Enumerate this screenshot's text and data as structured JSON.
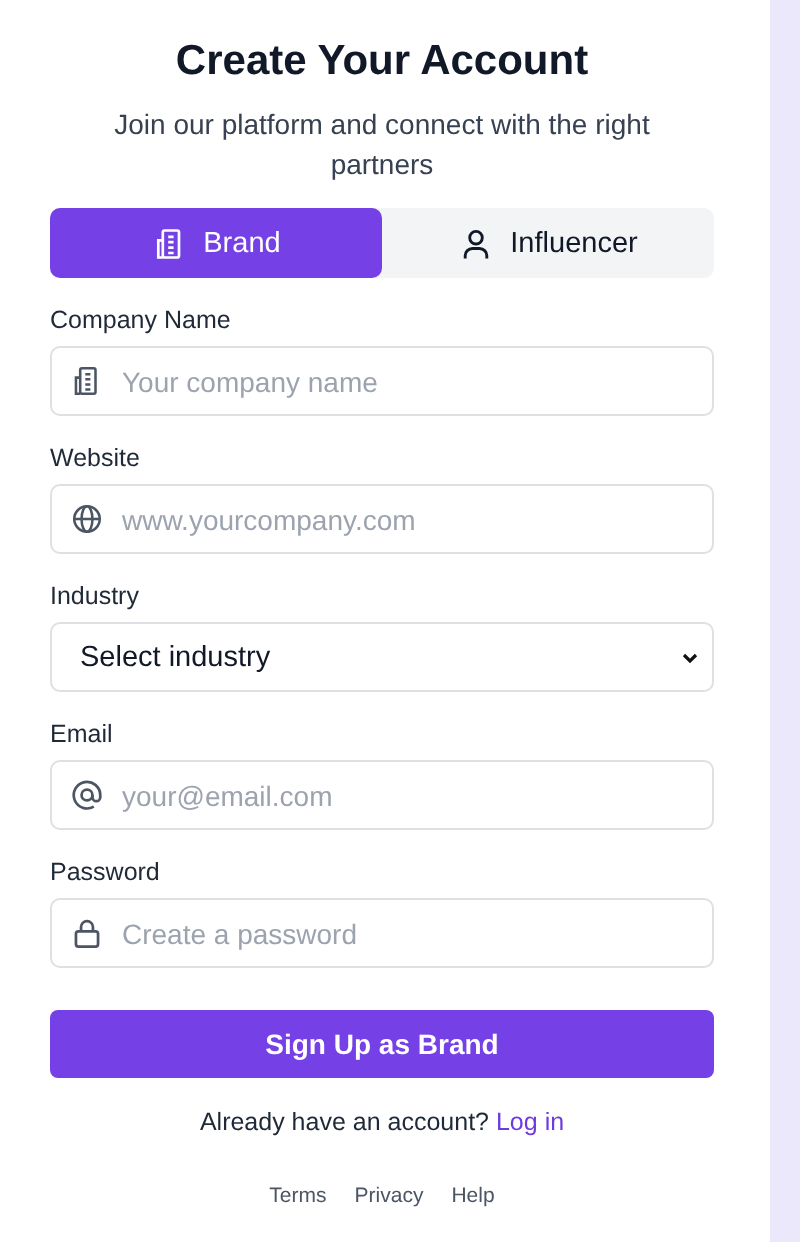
{
  "title": "Create Your Account",
  "subtitle": "Join our platform and connect with the right partners",
  "tabs": [
    {
      "label": "Brand",
      "selected": true
    },
    {
      "label": "Influencer",
      "selected": false
    }
  ],
  "fields": [
    {
      "kind": "company",
      "label": "Company Name",
      "placeholder": "Your company name"
    },
    {
      "kind": "website",
      "label": "Website",
      "placeholder": "www.yourcompany.com"
    },
    {
      "kind": "select",
      "label": "Industry",
      "value": "Select industry"
    },
    {
      "kind": "email",
      "label": "Email",
      "placeholder": "your@email.com"
    },
    {
      "kind": "password",
      "label": "Password",
      "placeholder": "Create a password"
    }
  ],
  "submit": "Sign Up as Brand",
  "login_prompt": "Already have an account?",
  "login_link": "Log in",
  "footer_links": [
    "Terms",
    "Privacy",
    "Help"
  ]
}
